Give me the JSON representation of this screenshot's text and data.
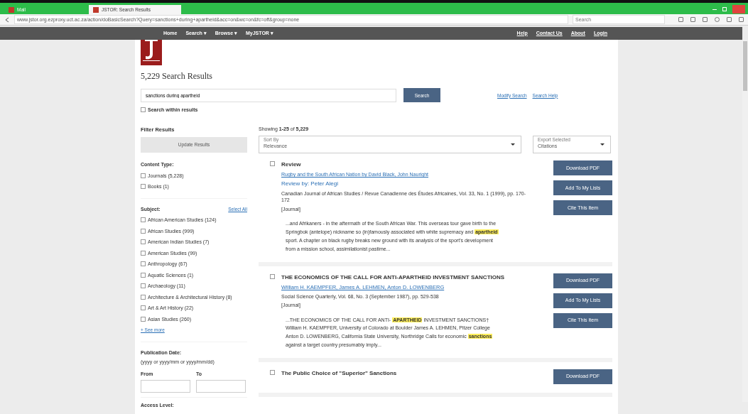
{
  "browser": {
    "tabs": [
      {
        "label": "Mail",
        "selected": false
      },
      {
        "label": "JSTOR: Search Results",
        "selected": true
      }
    ],
    "address": "www.jstor.org.ezproxy.uct.ac.za/action/doBasicSearch?Query=sanctions+during+apartheid&acc=on&wc=on&fc=off&group=none",
    "search_placeholder": "Search"
  },
  "nav": {
    "left": [
      "Home",
      "Search ▾",
      "Browse ▾",
      "MyJSTOR ▾"
    ],
    "right": [
      "Help",
      "Contact Us",
      "About",
      "Login"
    ]
  },
  "heading": "5,229 Search Results",
  "search": {
    "value": "sanctions during apartheid",
    "button": "Search",
    "links": [
      "Modify Search",
      "Search Help"
    ],
    "within": {
      "label": "Search within results",
      "checked": false
    }
  },
  "filters": {
    "title": "Filter Results",
    "update_button": "Update Results",
    "content_type": {
      "label": "Content Type:",
      "options": [
        {
          "label": "Journals (5,228)",
          "checked": false
        },
        {
          "label": "Books (1)",
          "checked": false
        }
      ]
    },
    "subject": {
      "label": "Subject:",
      "select_all": "Select All",
      "options": [
        {
          "label": "African American Studies (124)",
          "checked": false
        },
        {
          "label": "African Studies (999)",
          "checked": false
        },
        {
          "label": "American Indian Studies (7)",
          "checked": false
        },
        {
          "label": "American Studies (99)",
          "checked": false
        },
        {
          "label": "Anthropology (67)",
          "checked": false
        },
        {
          "label": "Aquatic Sciences (1)",
          "checked": false
        },
        {
          "label": "Archaeology (11)",
          "checked": false
        },
        {
          "label": "Architecture & Architectural History (8)",
          "checked": false
        },
        {
          "label": "Art & Art History (22)",
          "checked": false
        },
        {
          "label": "Asian Studies (260)",
          "checked": false
        }
      ],
      "see_more": "+ See more"
    },
    "date": {
      "label": "Publication Date:",
      "hint": "(yyyy or yyyy/mm or yyyy/mm/dd)",
      "from": "From",
      "to": "To"
    },
    "access": "Access Level:"
  },
  "showing": "Showing **1-25** of **5,229**",
  "sort": {
    "label": "Sort By",
    "value": "Relevance"
  },
  "export": {
    "label": "Export Selected",
    "value": "Citations"
  },
  "results": [
    {
      "title": "Review",
      "checked": false,
      "lines": [
        {
          "kind": "link",
          "text": "Rugby and the South African Nation by David Black, John Nauright"
        },
        {
          "kind": "reviewer",
          "text": "Review by: Peter Alegi"
        },
        {
          "kind": "plain",
          "text": "Canadian Journal of African Studies / Revue Canadienne des Études Africaines, Vol. 33, No. 1 (1999), pp. 170-172"
        },
        {
          "kind": "plain",
          "text": "[Journal]"
        }
      ],
      "snippet": "...and Afrikaners - in the aftermath of the South African War. This overseas tour gave birth to the Springbok (antelope) nickname so (in)famously associated with white supremacy and **apartheid** sport. A chapter on black rugby breaks new ground with its analysis of the sport's development from a mission school, assimilationist pastime...",
      "buttons": [
        "Download PDF",
        "Add To My Lists",
        "Cite This Item"
      ]
    },
    {
      "title": "THE ECONOMICS OF THE CALL FOR ANTI-APARTHEID INVESTMENT SANCTIONS",
      "checked": false,
      "lines": [
        {
          "kind": "authors",
          "text": "William H. KAEMPFER, James A. LEHMEN, Anton D. LOWENBERG"
        },
        {
          "kind": "plain",
          "text": "Social Science Quarterly, Vol. 68, No. 3 (September 1987), pp. 529-538"
        },
        {
          "kind": "plain",
          "text": "[Journal]"
        }
      ],
      "snippet": "...THE ECONOMICS OF THE CALL FOR ANTI- **APARTHEID** INVESTMENT SANCTIONS† William H. KAEMPFER, University of Colorado at Boulder James A. LEHMEN, Pitzer College Anton D. LOWENBERG, California State University, Northridge Calls for economic **sanctions** against a target country presumably imply...",
      "buttons": [
        "Download PDF",
        "Add To My Lists",
        "Cite This Item"
      ]
    },
    {
      "title": "The Public Choice of \"Superior\" Sanctions",
      "checked": false,
      "buttons": [
        "Download PDF"
      ]
    }
  ]
}
